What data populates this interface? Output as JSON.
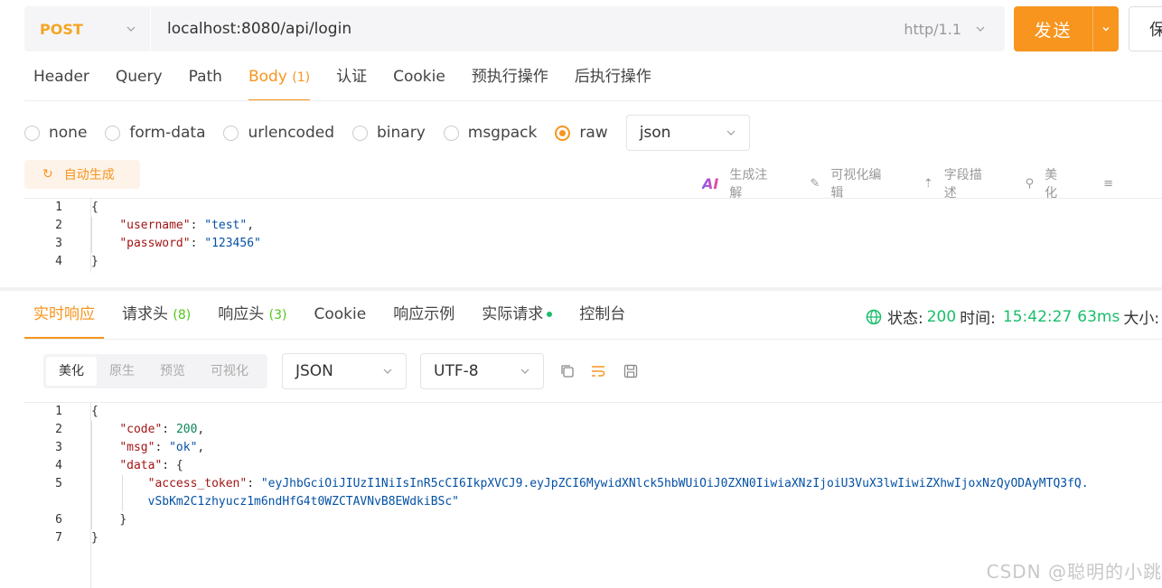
{
  "request": {
    "method": "POST",
    "url": "localhost:8080/api/login",
    "http_version": "http/1.1",
    "send_label": "发送",
    "save_label": "保"
  },
  "request_tabs": [
    {
      "label": "Header",
      "count": ""
    },
    {
      "label": "Query",
      "count": ""
    },
    {
      "label": "Path",
      "count": ""
    },
    {
      "label": "Body",
      "count": "(1)"
    },
    {
      "label": "认证",
      "count": ""
    },
    {
      "label": "Cookie",
      "count": ""
    },
    {
      "label": "预执行操作",
      "count": ""
    },
    {
      "label": "后执行操作",
      "count": ""
    }
  ],
  "body_types": [
    "none",
    "form-data",
    "urlencoded",
    "binary",
    "msgpack",
    "raw"
  ],
  "body_type_selected": "raw",
  "body_format": "json",
  "auto_generate_label": "自动生成",
  "body_tools": [
    "生成注解",
    "可视化编辑",
    "字段描述",
    "美化"
  ],
  "request_body_lines": [
    {
      "n": "1",
      "indent": "",
      "parts": [
        [
          "p",
          "{"
        ]
      ]
    },
    {
      "n": "2",
      "indent": "    ",
      "parts": [
        [
          "k",
          "\"username\""
        ],
        [
          "p",
          ": "
        ],
        [
          "s",
          "\"test\""
        ],
        [
          "p",
          ","
        ]
      ]
    },
    {
      "n": "3",
      "indent": "    ",
      "parts": [
        [
          "k",
          "\"password\""
        ],
        [
          "p",
          ": "
        ],
        [
          "s",
          "\"123456\""
        ]
      ]
    },
    {
      "n": "4",
      "indent": "",
      "parts": [
        [
          "p",
          "}"
        ]
      ]
    }
  ],
  "response_tabs": [
    {
      "label": "实时响应",
      "count": ""
    },
    {
      "label": "请求头",
      "count": "(8)"
    },
    {
      "label": "响应头",
      "count": "(3)"
    },
    {
      "label": "Cookie",
      "count": ""
    },
    {
      "label": "响应示例",
      "count": ""
    },
    {
      "label": "实际请求",
      "count": ""
    },
    {
      "label": "控制台",
      "count": ""
    }
  ],
  "response_status": {
    "status_label": "状态:",
    "status_value": "200",
    "time_label": "时间:",
    "time_value": "15:42:27",
    "duration": "63ms",
    "size_label": "大小:"
  },
  "view_modes": [
    "美化",
    "原生",
    "预览",
    "可视化"
  ],
  "response_format": "JSON",
  "response_encoding": "UTF-8",
  "response_body_lines": [
    {
      "n": "1",
      "indent": "",
      "parts": [
        [
          "p",
          "{"
        ]
      ]
    },
    {
      "n": "2",
      "indent": "    ",
      "parts": [
        [
          "k",
          "\"code\""
        ],
        [
          "p",
          ": "
        ],
        [
          "n",
          "200"
        ],
        [
          "p",
          ","
        ]
      ]
    },
    {
      "n": "3",
      "indent": "    ",
      "parts": [
        [
          "k",
          "\"msg\""
        ],
        [
          "p",
          ": "
        ],
        [
          "s",
          "\"ok\""
        ],
        [
          "p",
          ","
        ]
      ]
    },
    {
      "n": "4",
      "indent": "    ",
      "parts": [
        [
          "k",
          "\"data\""
        ],
        [
          "p",
          ": {"
        ]
      ]
    },
    {
      "n": "5",
      "indent": "        ",
      "parts": [
        [
          "k",
          "\"access_token\""
        ],
        [
          "p",
          ": "
        ],
        [
          "s",
          "\"eyJhbGciOiJIUzI1NiIsInR5cCI6IkpXVCJ9.eyJpZCI6MywidXNlck5hbWUiOiJ0ZXN0IiwiaXNzIjoiU3VuX3lwIiwiZXhwIjoxNzQyODAyMTQ3fQ."
        ]
      ]
    },
    {
      "n": "",
      "indent": "        ",
      "parts": [
        [
          "s",
          "vSbKm2C1zhyucz1m6ndHfG4t0WZCTAVNvB8EWdkiBSc\""
        ]
      ]
    },
    {
      "n": "6",
      "indent": "    ",
      "parts": [
        [
          "p",
          "}"
        ]
      ]
    },
    {
      "n": "7",
      "indent": "",
      "parts": [
        [
          "p",
          "}"
        ]
      ]
    }
  ],
  "watermark": "CSDN @聪明的小跳",
  "colors": {
    "accent": "#f7951e",
    "success": "#19be6b",
    "method": "#f5a623"
  }
}
